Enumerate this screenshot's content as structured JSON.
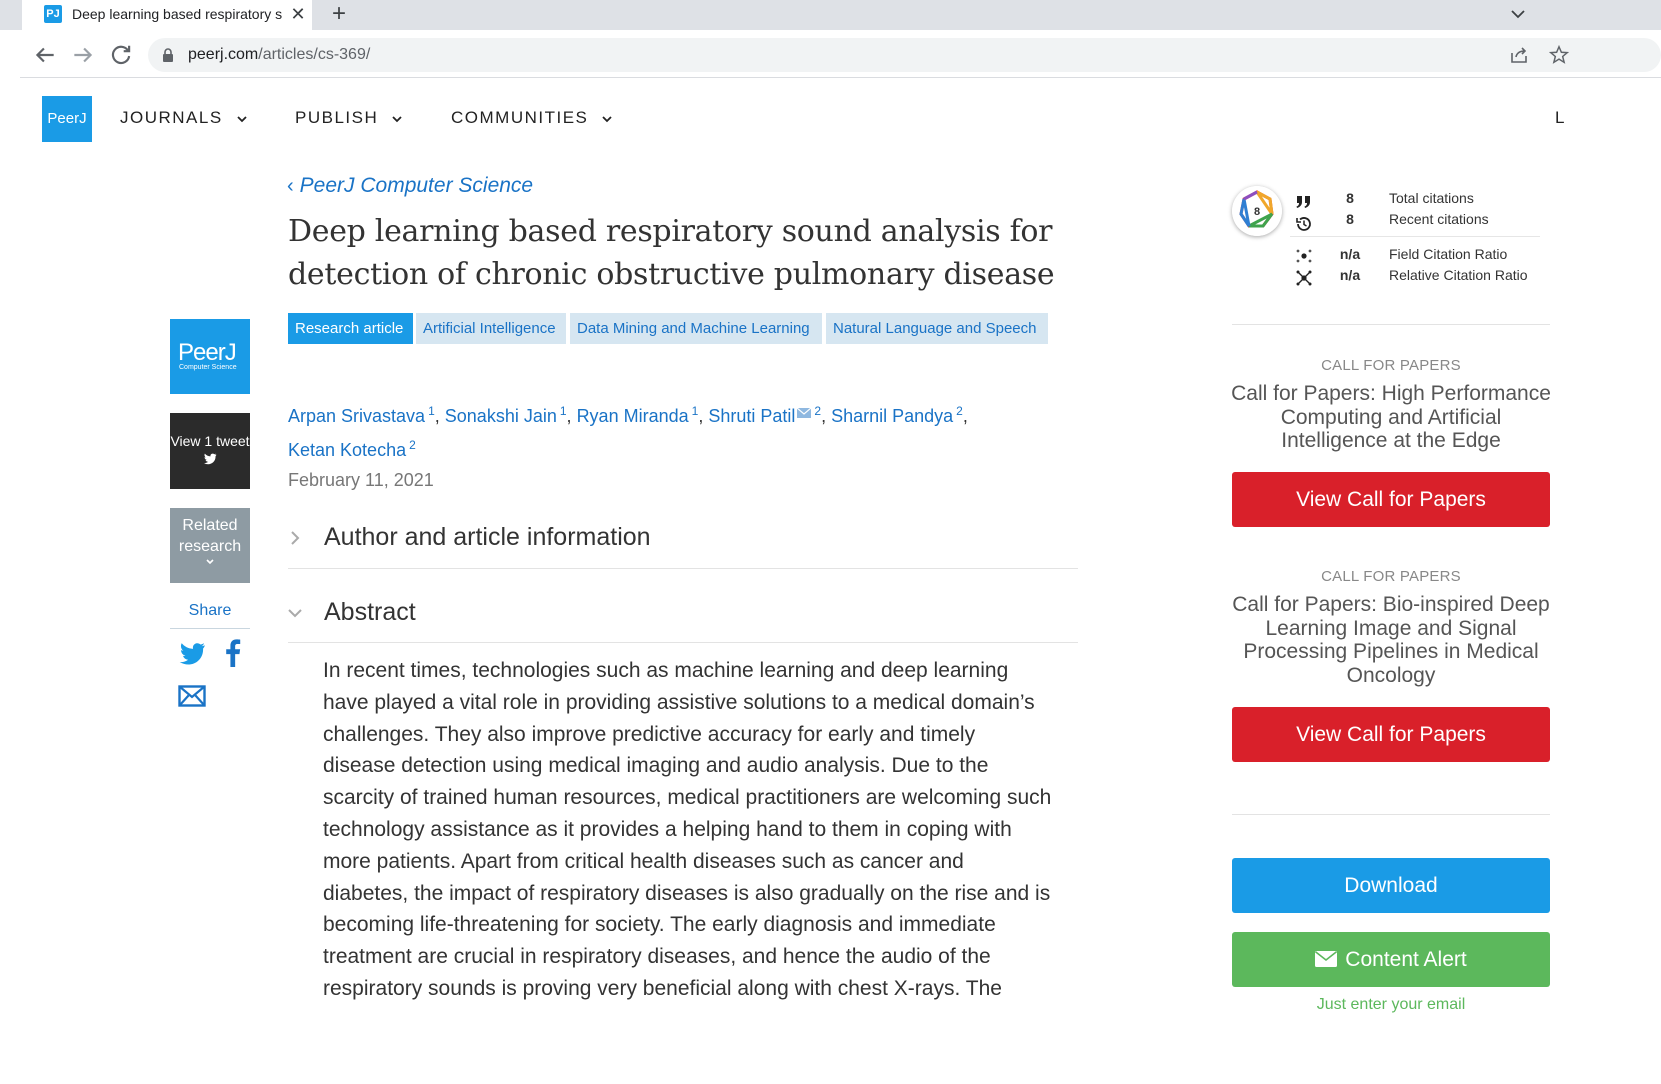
{
  "browser": {
    "tab_title": "Deep learning based respiratory sound analysis for detection of chronic obstructive pulmonary disease",
    "favicon_text": "PJ",
    "close_glyph": "✕",
    "new_tab_glyph": "+",
    "url_host": "peerj.com",
    "url_path": "/articles/cs-369/"
  },
  "site": {
    "logo_text": "PeerJ",
    "nav": [
      "JOURNALS",
      "PUBLISH",
      "COMMUNITIES"
    ],
    "nav_cut": "L"
  },
  "sidebar": {
    "journal_logo_big": "PeerJ",
    "journal_logo_small": "Computer Science",
    "tweet_label": "View 1 tweet",
    "related_line1": "Related",
    "related_line2": "research",
    "share_label": "Share"
  },
  "article": {
    "journal_link": "PeerJ Computer Science",
    "back_glyph": "‹",
    "title": "Deep learning based respiratory sound analysis for detection of chronic obstructive pulmonary disease",
    "tags": [
      {
        "label": "Research article",
        "primary": true
      },
      {
        "label": "Artificial Intelligence",
        "primary": false
      },
      {
        "label": "Data Mining and Machine Learning",
        "primary": false
      },
      {
        "label": "Natural Language and Speech",
        "primary": false
      }
    ],
    "authors": [
      {
        "name": "Arpan Srivastava",
        "aff": "1",
        "corresponding": false
      },
      {
        "name": "Sonakshi Jain",
        "aff": "1",
        "corresponding": false
      },
      {
        "name": "Ryan Miranda",
        "aff": "1",
        "corresponding": false
      },
      {
        "name": "Shruti Patil",
        "aff": "2",
        "corresponding": true
      },
      {
        "name": "Sharnil Pandya",
        "aff": "2",
        "corresponding": false
      },
      {
        "name": "Ketan Kotecha",
        "aff": "2",
        "corresponding": false
      }
    ],
    "date": "February 11, 2021",
    "section_author_info": "Author and article information",
    "section_abstract": "Abstract",
    "abstract_text": "In recent times, technologies such as machine learning and deep learning have played a vital role in providing assistive solutions to a medical domain’s challenges. They also improve predictive accuracy for early and timely disease detection using medical imaging and audio analysis. Due to the scarcity of trained human resources, medical practitioners are welcoming such technology assistance as it provides a helping hand to them in coping with more patients. Apart from critical health diseases such as cancer and diabetes, the impact of respiratory diseases is also gradually on the rise and is becoming life-threatening for society. The early diagnosis and immediate treatment are crucial in respiratory diseases, and hence the audio of the respiratory sounds is proving very beneficial along with chest X-rays. The"
  },
  "metrics": {
    "badge_score": "8",
    "total_citations": "8",
    "total_citations_label": "Total citations",
    "recent_citations": "8",
    "recent_citations_label": "Recent citations",
    "field_ratio": "n/a",
    "field_ratio_label": "Field Citation Ratio",
    "relative_ratio": "n/a",
    "relative_ratio_label": "Relative Citation Ratio"
  },
  "calls": [
    {
      "kicker": "CALL FOR PAPERS",
      "title": "Call for Papers: High Performance Computing and Artificial Intelligence at the Edge",
      "button": "View Call for Papers"
    },
    {
      "kicker": "CALL FOR PAPERS",
      "title": "Call for Papers: Bio-inspired Deep Learning Image and Signal Processing Pipelines in Medical Oncology",
      "button": "View Call for Papers"
    }
  ],
  "actions": {
    "download": "Download",
    "content_alert": "Content Alert",
    "enter_email": "Just enter your email"
  },
  "colors": {
    "brand_blue": "#1a9be6",
    "link_blue": "#1a73c6",
    "cfp_red": "#d9202a",
    "alert_green": "#5cb85c"
  }
}
